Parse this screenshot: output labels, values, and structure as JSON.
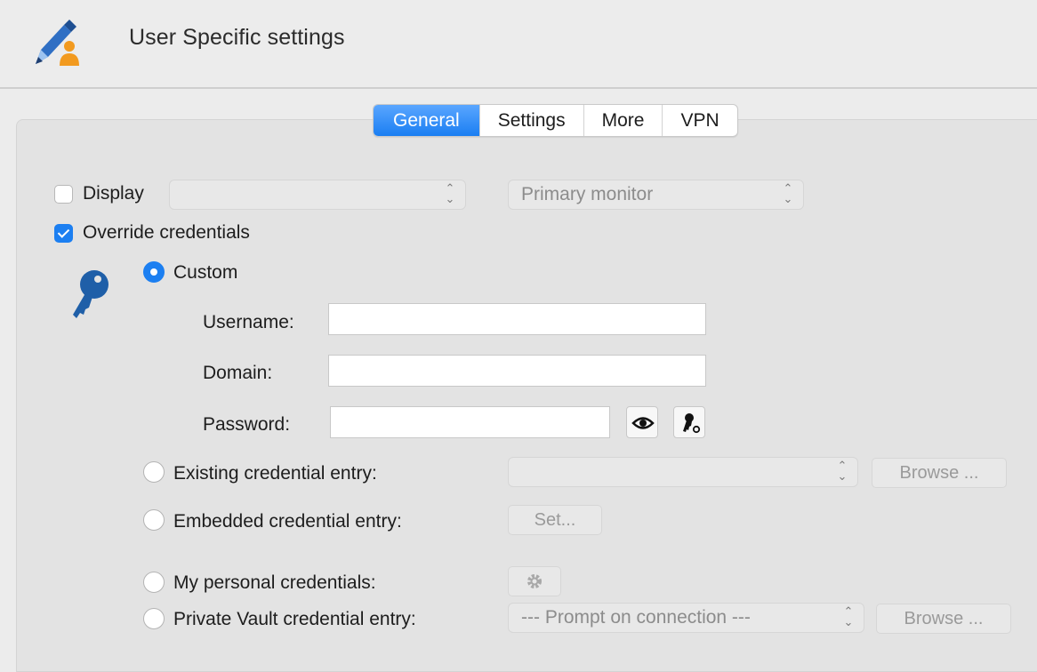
{
  "window": {
    "title": "User Specific settings"
  },
  "tabs": [
    {
      "label": "General",
      "active": true
    },
    {
      "label": "Settings",
      "active": false
    },
    {
      "label": "More",
      "active": false
    },
    {
      "label": "VPN",
      "active": false
    }
  ],
  "display": {
    "checkbox_label": "Display",
    "checked": false,
    "select_value": "",
    "monitor_value": "Primary monitor"
  },
  "override": {
    "label": "Override credentials",
    "checked": true
  },
  "credentials": {
    "custom_label": "Custom",
    "username_label": "Username:",
    "username_value": "",
    "domain_label": "Domain:",
    "domain_value": "",
    "password_label": "Password:",
    "password_value": "",
    "existing_label": "Existing credential entry:",
    "existing_value": "",
    "existing_browse": "Browse ...",
    "embedded_label": "Embedded credential entry:",
    "embedded_set": "Set...",
    "personal_label": "My personal credentials:",
    "vault_label": "Private Vault credential entry:",
    "vault_value": "--- Prompt on connection ---",
    "vault_browse": "Browse ..."
  },
  "icons": {
    "app": "pencil-user-icon",
    "key": "key-icon",
    "show_password": "eye-icon",
    "password_generator": "key-gear-icon",
    "settings": "gear-icon"
  },
  "colors": {
    "accent": "#1c7ff1",
    "key_blue": "#1f5fa8"
  }
}
